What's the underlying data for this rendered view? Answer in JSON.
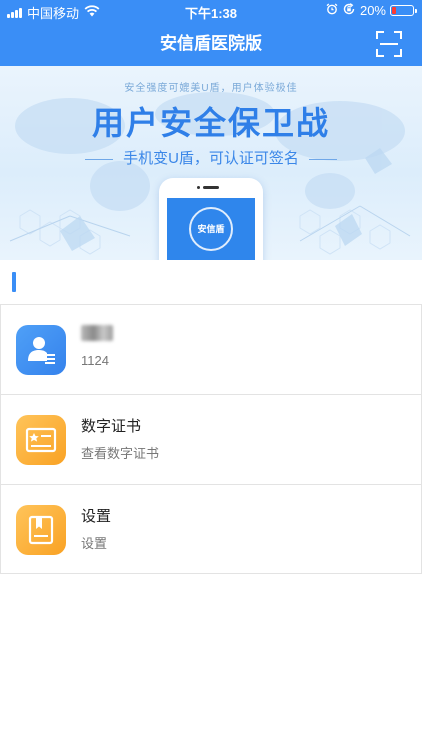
{
  "status_bar": {
    "carrier": "中国移动",
    "time": "下午1:38",
    "battery_percent": "20%",
    "battery_level": 0.2,
    "icons": [
      "signal-icon",
      "wifi-icon",
      "alarm-icon",
      "rotation-lock-icon",
      "battery-icon"
    ]
  },
  "nav": {
    "title": "安信盾医院版",
    "scan_icon": "scan-icon"
  },
  "banner": {
    "subtitle": "安全强度可媲美U盾，用户体验极佳",
    "title": "用户安全保卫战",
    "slogan": "手机变U盾，可认证可签名",
    "phone_label": "安信盾"
  },
  "colors": {
    "primary": "#3a8ef6",
    "orange": "#f9a224",
    "banner_title": "#2f7fe8"
  },
  "list": [
    {
      "icon": "user-card-icon",
      "color": "blue",
      "title": "",
      "title_obscured": true,
      "subtitle": "1124"
    },
    {
      "icon": "certificate-icon",
      "color": "orange",
      "title": "数字证书",
      "subtitle": "查看数字证书"
    },
    {
      "icon": "settings-book-icon",
      "color": "orange",
      "title": "设置",
      "subtitle": "设置"
    }
  ]
}
